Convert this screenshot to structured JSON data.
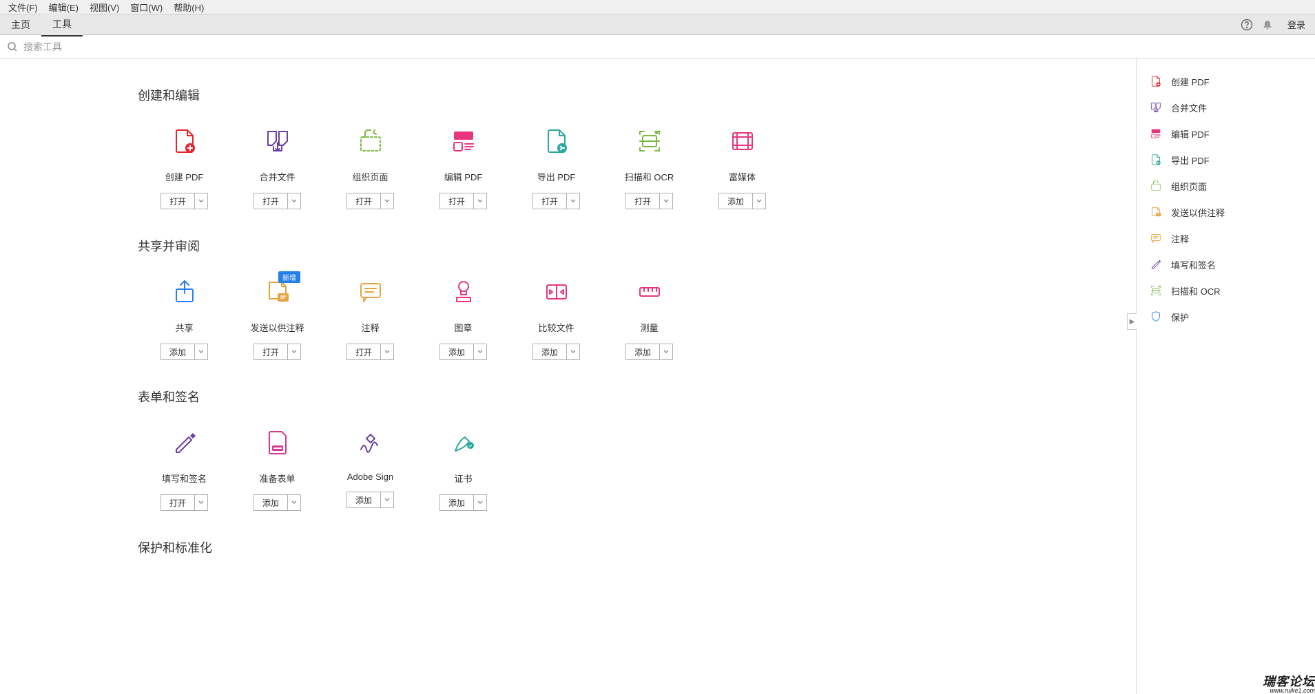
{
  "menu": {
    "file": "文件(F)",
    "edit": "编辑(E)",
    "view": "视图(V)",
    "window": "窗口(W)",
    "help": "帮助(H)"
  },
  "tabs": {
    "home": "主页",
    "tools": "工具",
    "login": "登录"
  },
  "search": {
    "placeholder": "搜索工具"
  },
  "buttons": {
    "open": "打开",
    "add": "添加"
  },
  "sections": {
    "create_edit": {
      "title": "创建和编辑",
      "tools": [
        {
          "id": "create-pdf",
          "label": "创建 PDF",
          "btn": "打开",
          "color": "#e8232a",
          "icon": "create-pdf"
        },
        {
          "id": "combine",
          "label": "合并文件",
          "btn": "打开",
          "color": "#6b3fa0",
          "icon": "combine"
        },
        {
          "id": "organize",
          "label": "组织页面",
          "btn": "打开",
          "color": "#7bb83f",
          "icon": "organize"
        },
        {
          "id": "edit-pdf",
          "label": "编辑 PDF",
          "btn": "打开",
          "color": "#e8357f",
          "icon": "edit-pdf"
        },
        {
          "id": "export-pdf",
          "label": "导出 PDF",
          "btn": "打开",
          "color": "#2aa89e",
          "icon": "export-pdf"
        },
        {
          "id": "scan-ocr",
          "label": "扫描和 OCR",
          "btn": "打开",
          "color": "#7bb83f",
          "icon": "scan-ocr"
        },
        {
          "id": "rich-media",
          "label": "富媒体",
          "btn": "添加",
          "color": "#e8357f",
          "icon": "rich-media"
        }
      ]
    },
    "share_review": {
      "title": "共享并审阅",
      "tools": [
        {
          "id": "share",
          "label": "共享",
          "btn": "添加",
          "color": "#2680eb",
          "icon": "share"
        },
        {
          "id": "send-comments",
          "label": "发送以供注释",
          "btn": "打开",
          "color": "#e8a33d",
          "icon": "send-comments",
          "badge": "新增"
        },
        {
          "id": "comment",
          "label": "注释",
          "btn": "打开",
          "color": "#e8a33d",
          "icon": "comment"
        },
        {
          "id": "stamp",
          "label": "图章",
          "btn": "添加",
          "color": "#e8357f",
          "icon": "stamp"
        },
        {
          "id": "compare",
          "label": "比较文件",
          "btn": "添加",
          "color": "#e8357f",
          "icon": "compare"
        },
        {
          "id": "measure",
          "label": "测量",
          "btn": "添加",
          "color": "#e8357f",
          "icon": "measure"
        }
      ]
    },
    "forms_sign": {
      "title": "表单和签名",
      "tools": [
        {
          "id": "fill-sign",
          "label": "填写和签名",
          "btn": "打开",
          "color": "#6b3fa0",
          "icon": "fill-sign"
        },
        {
          "id": "prepare-form",
          "label": "准备表单",
          "btn": "添加",
          "color": "#d83790",
          "icon": "prepare-form"
        },
        {
          "id": "adobe-sign",
          "label": "Adobe Sign",
          "btn": "添加",
          "color": "#6b3fa0",
          "icon": "adobe-sign"
        },
        {
          "id": "certificates",
          "label": "证书",
          "btn": "添加",
          "color": "#2aa89e",
          "icon": "certificates"
        }
      ]
    },
    "protect": {
      "title": "保护和标准化",
      "tools": []
    }
  },
  "sidebar": [
    {
      "id": "create-pdf",
      "label": "创建 PDF",
      "color": "#e8232a"
    },
    {
      "id": "combine",
      "label": "合并文件",
      "color": "#6b3fa0"
    },
    {
      "id": "edit-pdf",
      "label": "编辑 PDF",
      "color": "#e8357f"
    },
    {
      "id": "export-pdf",
      "label": "导出 PDF",
      "color": "#2aa89e"
    },
    {
      "id": "organize",
      "label": "组织页面",
      "color": "#7bb83f"
    },
    {
      "id": "send-comments",
      "label": "发送以供注释",
      "color": "#e8a33d"
    },
    {
      "id": "comment",
      "label": "注释",
      "color": "#e8a33d"
    },
    {
      "id": "fill-sign",
      "label": "填写和签名",
      "color": "#6b3fa0"
    },
    {
      "id": "scan-ocr",
      "label": "扫描和 OCR",
      "color": "#7bb83f"
    },
    {
      "id": "protect",
      "label": "保护",
      "color": "#2680eb"
    }
  ],
  "watermark": {
    "main": "瑞客论坛",
    "sub": "www.ruike1.com"
  }
}
